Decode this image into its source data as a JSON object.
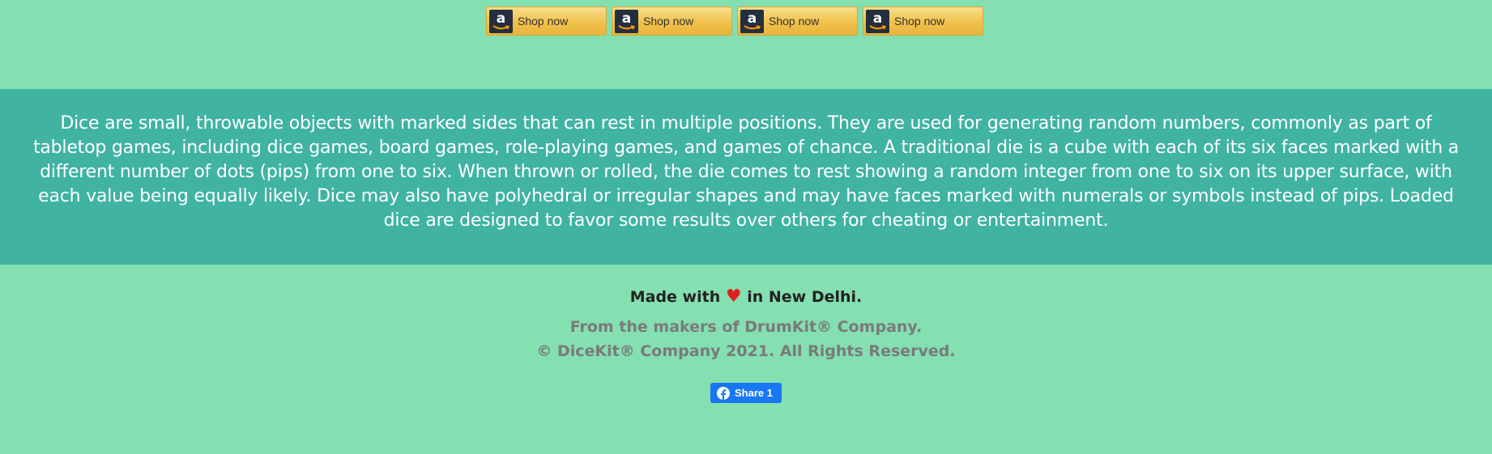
{
  "shop_buttons": [
    {
      "label": "Shop now",
      "icon": "amazon-logo-icon"
    },
    {
      "label": "Shop now",
      "icon": "amazon-logo-icon"
    },
    {
      "label": "Shop now",
      "icon": "amazon-logo-icon"
    },
    {
      "label": "Shop now",
      "icon": "amazon-logo-icon"
    }
  ],
  "description": "Dice are small, throwable objects with marked sides that can rest in multiple positions. They are used for generating random numbers, commonly as part of tabletop games, including dice games, board games, role-playing games, and games of chance. A traditional die is a cube with each of its six faces marked with a different number of dots (pips) from one to six. When thrown or rolled, the die comes to rest showing a random integer from one to six on its upper surface, with each value being equally likely. Dice may also have polyhedral or irregular shapes and may have faces marked with numerals or symbols instead of pips. Loaded dice are designed to favor some results over others for cheating or entertainment.",
  "footer": {
    "made_with_prefix": "Made with",
    "heart_icon": "heart-icon",
    "made_with_suffix": "in New Delhi.",
    "makers_line": "From the makers of DrumKit® Company.",
    "copyright_line": "© DiceKit® Company 2021. All Rights Reserved.",
    "share_label": "Share 1"
  },
  "colors": {
    "page_background": "#84dfb1",
    "band_background": "#40b3a2",
    "heart": "#e02020",
    "facebook_blue": "#1877f2",
    "shop_button": "#f0c14b"
  }
}
